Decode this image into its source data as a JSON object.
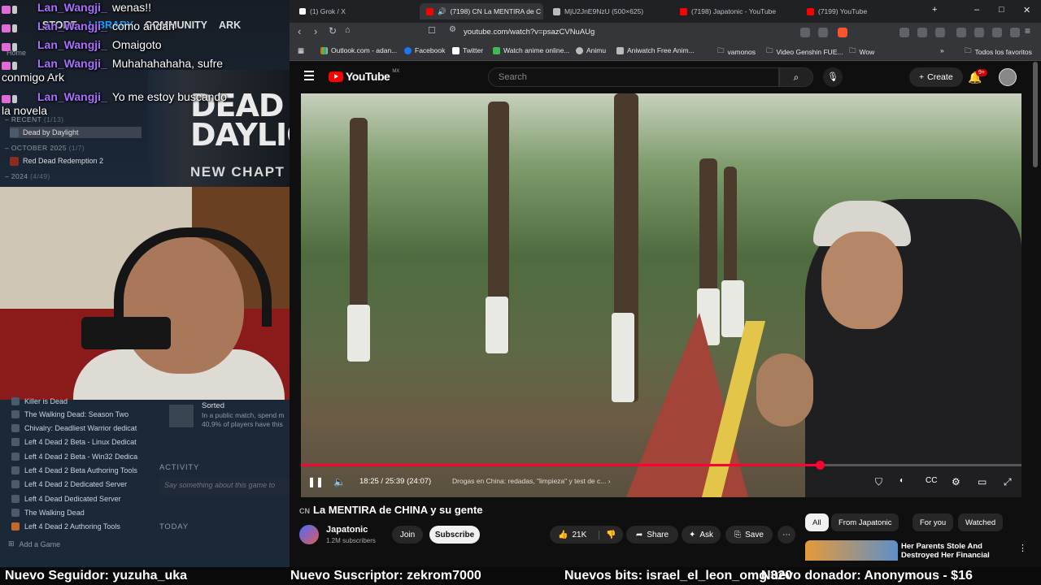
{
  "steam": {
    "nav": [
      "STORE",
      "LIBRARY",
      "COMMUNITY",
      "ARK"
    ],
    "home": "Home",
    "sections": [
      {
        "label": "RECENT",
        "count": "(1/13)"
      },
      {
        "label": "OCTOBER 2025",
        "count": "(1/7)"
      },
      {
        "label": "2024",
        "count": "(4/49)"
      }
    ],
    "recent_items": [
      "Dead by Daylight",
      "Red Dead Redemption 2"
    ],
    "banner": {
      "line1": "DEAD",
      "line2": "DAYLIG",
      "line3": "NEW CHAPT"
    },
    "lower_items": [
      "Killer is Dead",
      "The Walking Dead: Season Two",
      "Chivalry: Deadliest Warrior dedicat",
      "Left 4 Dead 2 Beta - Linux Dedicat",
      "Left 4 Dead 2 Beta - Win32 Dedica",
      "Left 4 Dead 2 Beta Authoring Tools",
      "Left 4 Dead 2 Dedicated Server",
      "Left 4 Dead Dedicated Server",
      "The Walking Dead",
      "Left 4 Dead 2 Authoring Tools"
    ],
    "achievement": {
      "title": "Sorted",
      "line1": "In a public match, spend m",
      "line2": "40,9% of players have this"
    },
    "activity_label": "ACTIVITY",
    "activity_placeholder": "Say something about this game to",
    "today_label": "TODAY",
    "add_game": "Add a Game"
  },
  "chat": [
    {
      "user": "Lan_Wangji_",
      "msg": "wenas!!"
    },
    {
      "user": "Lan_Wangji_",
      "msg": "como andan"
    },
    {
      "user": "Lan_Wangji_",
      "msg": "Omaigoto"
    },
    {
      "user": "Lan_Wangji_",
      "msg": "Muhahahahaha, sufre"
    },
    {
      "user": "",
      "msg": "conmigo Ark"
    },
    {
      "user": "Lan_Wangji_",
      "msg": "Yo me estoy buscando"
    },
    {
      "user": "",
      "msg": "la novela"
    }
  ],
  "browser": {
    "tabs": [
      "(1) Grok / X",
      "(7198) CN La MENTIRA de C",
      "MjU2JnE9NzU (500×625)",
      "(7198) Japatonic - YouTube",
      "(7199) YouTube"
    ],
    "new_tab": "+",
    "url": "youtube.com/watch?v=psazCVNuAUg",
    "bookmarks": [
      "Outlook.com - adan...",
      "Facebook",
      "Twitter",
      "Watch anime online...",
      "Animu",
      "Aniwatch Free Anim...",
      "vamonos",
      "Video Genshin FUE...",
      "Wow"
    ],
    "all_bookmarks": "Todos los favoritos"
  },
  "youtube": {
    "logo": "YouTube",
    "country": "MX",
    "search_placeholder": "Search",
    "create": "Create",
    "notif_badge": "9+",
    "player": {
      "current_time": "18:25",
      "duration": "25:39",
      "remaining": "(24:07)",
      "time_display": "18:25 / 25:39 (24:07)",
      "chapter": "Drogas en China: redadas, \"limpieza\" y test de c...",
      "progress": 0.72
    },
    "video_title_prefix": "CN",
    "video_title": "La MENTIRA de CHINA y su gente",
    "channel": "Japatonic",
    "subscribers": "1.2M subscribers",
    "join": "Join",
    "subscribe": "Subscribe",
    "likes": "21K",
    "share": "Share",
    "ask": "Ask",
    "save": "Save",
    "chips": [
      "All",
      "From Japatonic",
      "For you",
      "Watched"
    ],
    "rec_title": "Her Parents Stole And Destroyed Her Financial Futur..."
  },
  "ticker": {
    "follower": "Nuevo Seguidor: yuzuha_uka",
    "subscriber": "Nuevo Suscriptor: zekrom7000",
    "bits": "Nuevos bits: israel_el_leon_omg 320",
    "donor": "Nuevo donador: Anonymous - $16",
    "overlap": "Dax - 1"
  }
}
